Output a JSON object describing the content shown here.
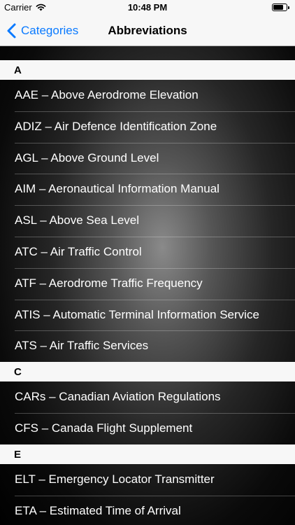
{
  "status_bar": {
    "carrier": "Carrier",
    "time": "10:48 PM",
    "icons": [
      "wifi-icon",
      "battery-icon"
    ],
    "battery_level": 0.75
  },
  "nav_bar": {
    "back_label": "Categories",
    "title": "Abbreviations",
    "accent_color": "#0a7aff"
  },
  "sections": [
    {
      "letter": "A",
      "items": [
        "AAE – Above Aerodrome Elevation",
        "ADIZ – Air Defence Identification Zone",
        "AGL – Above Ground Level",
        "AIM – Aeronautical Information Manual",
        "ASL – Above Sea Level",
        "ATC – Air Traffic Control",
        "ATF – Aerodrome Traffic Frequency",
        "ATIS – Automatic Terminal Information Service",
        "ATS – Air Traffic Services"
      ]
    },
    {
      "letter": "C",
      "items": [
        "CARs – Canadian Aviation Regulations",
        "CFS – Canada Flight Supplement"
      ]
    },
    {
      "letter": "E",
      "items": [
        "ELT – Emergency Locator Transmitter",
        "ETA – Estimated Time of Arrival"
      ]
    }
  ]
}
